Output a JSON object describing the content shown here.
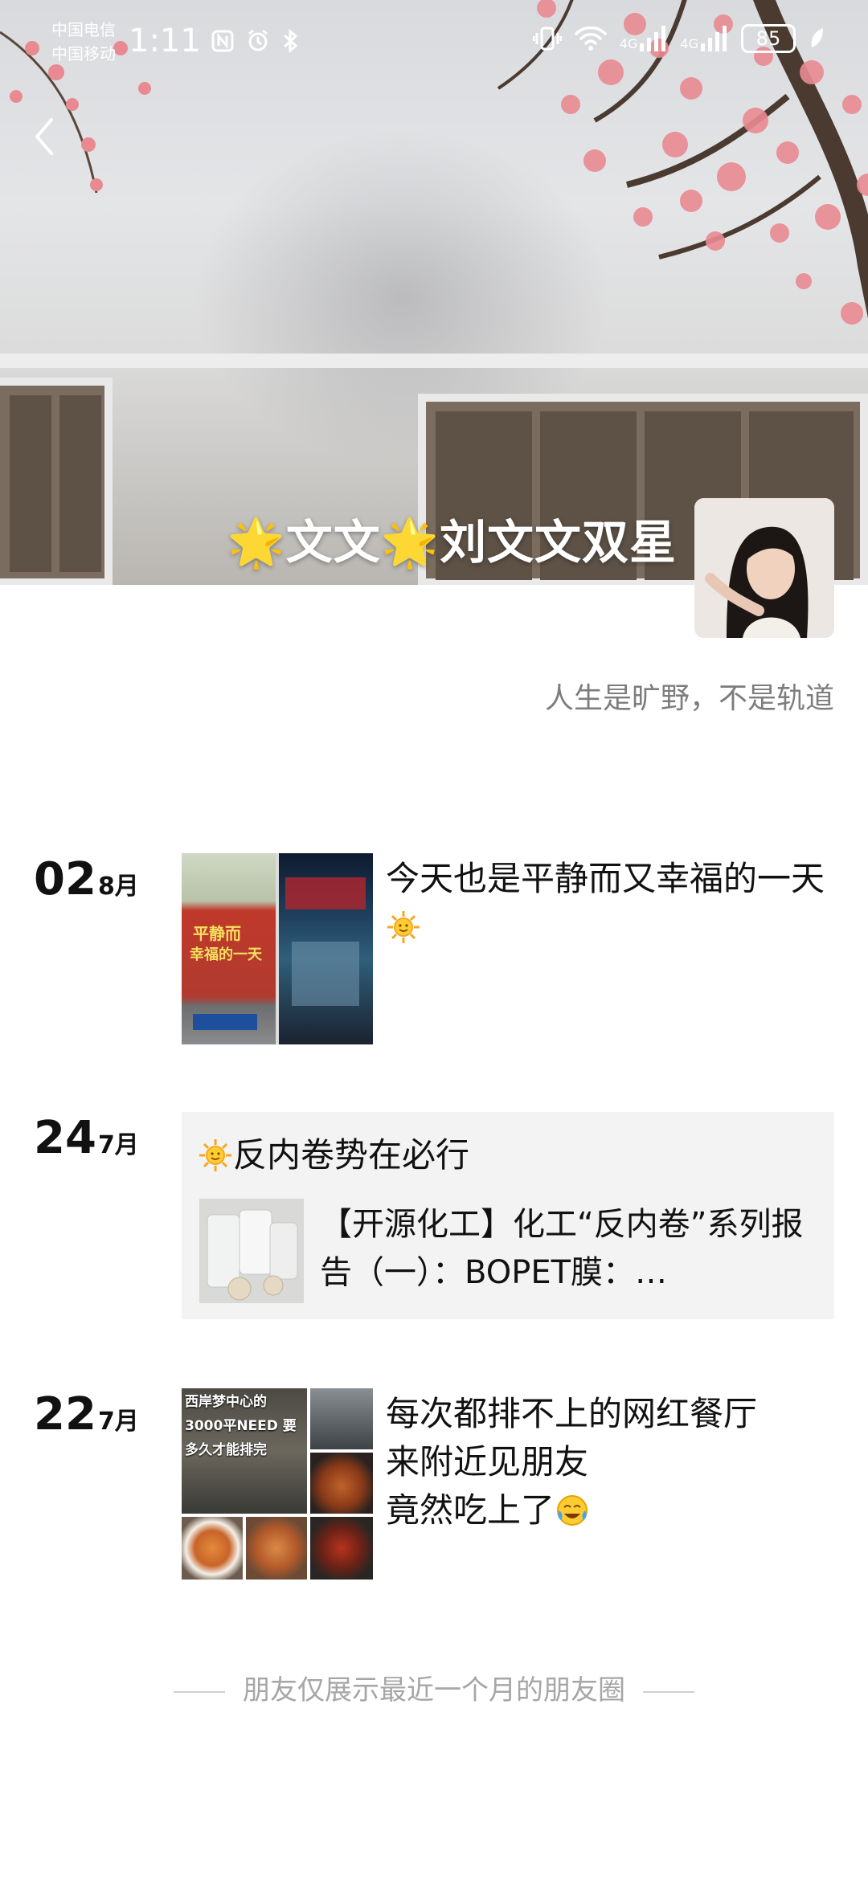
{
  "status_bar": {
    "carrier_1": "中国电信",
    "carrier_2": "中国移动",
    "time": "1:11",
    "network_1": "4G",
    "network_2": "4G",
    "battery": "85"
  },
  "profile": {
    "display_name": "🌟文文🌟刘文文双星",
    "signature": "人生是旷野，不是轨道"
  },
  "posts": [
    {
      "day": "02",
      "month": "8月",
      "text": "今天也是平静而又幸福的一天",
      "image_text_1": "平静而",
      "image_text_2": "幸福的一天"
    },
    {
      "day": "24",
      "month": "7月",
      "caption": "反内卷势在必行",
      "shared_title": "【开源化工】化工“反内卷”系列报告（一）：BOPET膜：…"
    },
    {
      "day": "22",
      "month": "7月",
      "text_line_1": "每次都排不上的网红餐厅",
      "text_line_2": "来附近见朋友",
      "text_line_3": "竟然吃上了",
      "image_caption": "西岸梦中心的 3000平NEED 要多久才能排完"
    }
  ],
  "footer": {
    "note": "朋友仅展示最近一个月的朋友圈"
  },
  "colors": {
    "blossom": "#e98a92",
    "card_bg": "#f3f3f3",
    "muted_text": "#7d7d7d"
  }
}
